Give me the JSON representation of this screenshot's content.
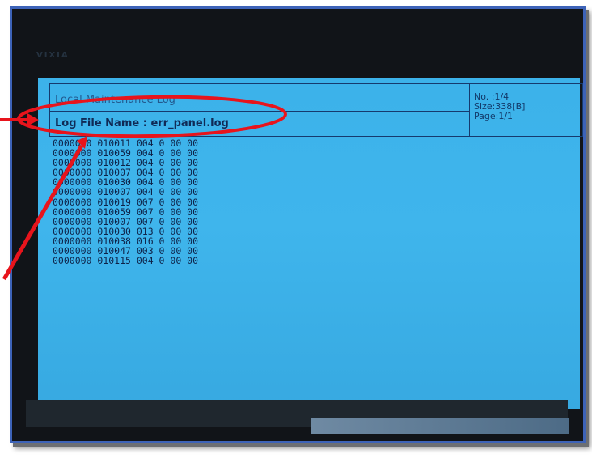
{
  "brand": "VIXIA",
  "panel": {
    "title": "Local Maintenance Log",
    "file_name": "Log File Name : err_panel.log",
    "no": "No. :1/4",
    "size": "Size:338[B]",
    "page": "Page:1/1"
  },
  "log_lines": [
    "0000000 010011 004 0 00 00",
    "0000000 010059 004 0 00 00",
    "0000000 010012 004 0 00 00",
    "0000000 010007 004 0 00 00",
    "0000000 010030 004 0 00 00",
    "0000000 010007 004 0 00 00",
    "0000000 010019 007 0 00 00",
    "0000000 010059 007 0 00 00",
    "0000000 010007 007 0 00 00",
    "0000000 010030 013 0 00 00",
    "0000000 010038 016 0 00 00",
    "0000000 010047 003 0 00 00",
    "0000000 010115 004 0 00 00"
  ],
  "colors": {
    "screen_bg": "#3cb2ea",
    "annotation": "#e8141c",
    "frame_border": "#3d63b8"
  }
}
